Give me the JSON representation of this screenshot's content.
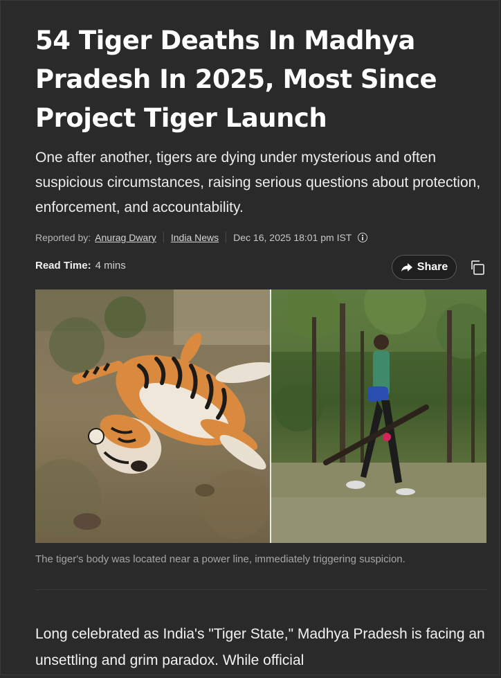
{
  "article": {
    "headline": "54 Tiger Deaths In Madhya Pradesh In 2025, Most Since Project Tiger Launch",
    "subhead": "One after another, tigers are dying under mysterious and often suspicious circumstances, raising serious questions about protection, enforcement, and accountability.",
    "reported_by_label": "Reported by:",
    "author": "Anurag Dwary",
    "outlet": "India News",
    "date": "Dec 16, 2025 18:01 pm IST",
    "read_time_label": "Read Time:",
    "read_time_value": "4 mins",
    "share_label": "Share",
    "image_caption": "The tiger's body was located near a power line, immediately triggering suspicion.",
    "body_start": "Long celebrated as India's \"Tiger State,\" Madhya Pradesh is facing an unsettling and grim paradox. While official"
  },
  "icons": {
    "info": "info-icon",
    "share": "share-arrow-icon",
    "copy": "copy-icon"
  },
  "colors": {
    "background": "#2a2a2a",
    "text": "#ffffff"
  }
}
